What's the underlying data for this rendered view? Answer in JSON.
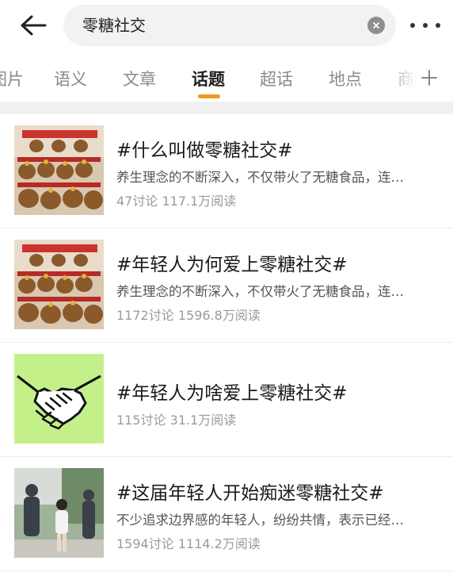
{
  "search": {
    "query": "零糖社交"
  },
  "tabs": [
    "图片",
    "语义",
    "文章",
    "话题",
    "超话",
    "地点",
    "商"
  ],
  "active_tab": "话题",
  "results": [
    {
      "title": "#什么叫做零糖社交#",
      "desc": "养生理念的不断深入，不仅带火了无糖食品，连…",
      "discussions": "47讨论",
      "reads": "117.1万阅读",
      "thumb_icon": "capybara-plush-image"
    },
    {
      "title": "#年轻人为何爱上零糖社交#",
      "desc": "养生理念的不断深入，不仅带火了无糖食品，连…",
      "discussions": "1172讨论",
      "reads": "1596.8万阅读",
      "thumb_icon": "capybara-plush-image"
    },
    {
      "title": "#年轻人为啥爱上零糖社交#",
      "desc": "",
      "discussions": "115讨论",
      "reads": "31.1万阅读",
      "thumb_icon": "handshake-icon"
    },
    {
      "title": "#这届年轻人开始痴迷零糖社交#",
      "desc": "不少追求边界感的年轻人，纷纷共情，表示已经…",
      "discussions": "1594讨论",
      "reads": "1114.2万阅读",
      "thumb_icon": "people-photo-image"
    }
  ]
}
